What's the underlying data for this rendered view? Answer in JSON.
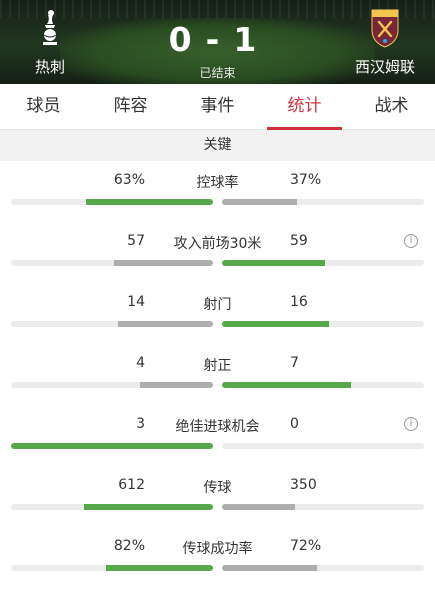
{
  "match": {
    "home_team": "热刺",
    "away_team": "西汉姆联",
    "home_score": "0",
    "away_score": "1",
    "separator": "-",
    "status": "已结束"
  },
  "tabs": [
    {
      "label": "球员",
      "active": false
    },
    {
      "label": "阵容",
      "active": false
    },
    {
      "label": "事件",
      "active": false
    },
    {
      "label": "统计",
      "active": true
    },
    {
      "label": "战术",
      "active": false
    }
  ],
  "section_title": "关键",
  "stats": [
    {
      "label": "控球率",
      "home": "63%",
      "away": "37%",
      "home_share": 0.63,
      "away_share": 0.37,
      "info": false
    },
    {
      "label": "攻入前场30米",
      "home": "57",
      "away": "59",
      "home_share": 0.49,
      "away_share": 0.51,
      "info": true
    },
    {
      "label": "射门",
      "home": "14",
      "away": "16",
      "home_share": 0.47,
      "away_share": 0.53,
      "info": false
    },
    {
      "label": "射正",
      "home": "4",
      "away": "7",
      "home_share": 0.36,
      "away_share": 0.64,
      "info": false
    },
    {
      "label": "绝佳进球机会",
      "home": "3",
      "away": "0",
      "home_share": 1.0,
      "away_share": 0.0,
      "info": true
    },
    {
      "label": "传球",
      "home": "612",
      "away": "350",
      "home_share": 0.64,
      "away_share": 0.36,
      "info": false
    },
    {
      "label": "传球成功率",
      "home": "82%",
      "away": "72%",
      "home_share": 0.53,
      "away_share": 0.47,
      "info": false
    }
  ],
  "colors": {
    "accent": "#d0323d",
    "leader_bar": "#57a84a",
    "trailing_bar": "#adadad"
  },
  "icons": {
    "home_crest": "tottenham-crest-icon",
    "away_crest": "west-ham-crest-icon",
    "info": "info-icon"
  }
}
